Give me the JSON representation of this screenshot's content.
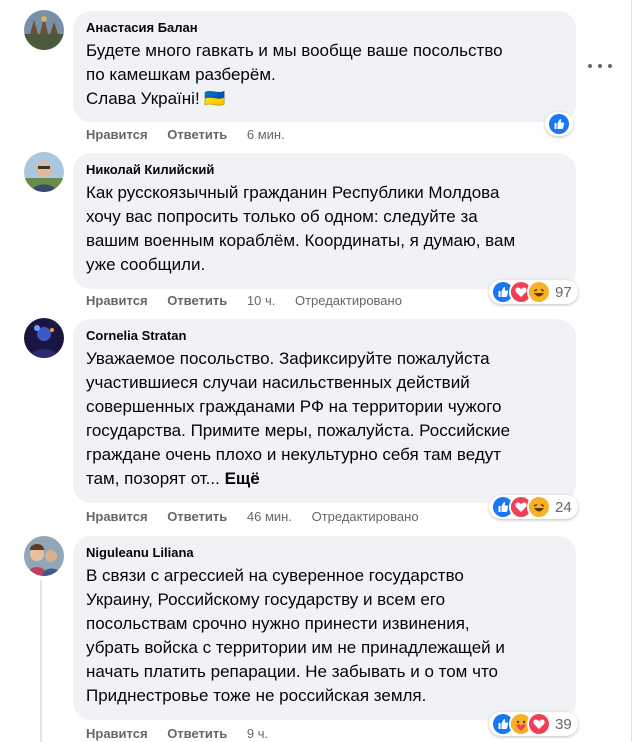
{
  "comments": [
    {
      "author": "Анастасия Балан",
      "text": "Будете много гавкать и мы вообще ваше посольство\nпо камешкам разберём.\nСлава Україні! 🇺🇦",
      "like": "Нравится",
      "reply": "Ответить",
      "time": "6 мин.",
      "edited": "",
      "reactions": [
        "like"
      ],
      "count": ""
    },
    {
      "author": "Николай Килийский",
      "text": "Как русскоязычный гражданин Республики Молдова\nхочу вас попросить только об одном: следуйте за\nвашим военным кораблём. Координаты, я думаю, вам\nуже сообщили.",
      "like": "Нравится",
      "reply": "Ответить",
      "time": "10 ч.",
      "edited": "Отредактировано",
      "reactions": [
        "like",
        "love",
        "haha"
      ],
      "count": "97"
    },
    {
      "author": "Cornelia Stratan",
      "text": "Уважаемое посольство. Зафиксируйте пожалуйста\nучастившиеся случаи насильственных действий\nсовершенных гражданами РФ на территории чужого\nгосударства. Примите меры, пожалуйста. Российские\nграждане очень плохо и некультурно себя там ведут\nтам, позорят от...",
      "more": "Ещё",
      "like": "Нравится",
      "reply": "Ответить",
      "time": "46 мин.",
      "edited": "Отредактировано",
      "reactions": [
        "like",
        "love",
        "haha"
      ],
      "count": "24"
    },
    {
      "author": "Niguleanu Liliana",
      "text": "В связи с агрессией на суверенное государство\nУкраину, Российскому государству и всем его\nпосольствам срочно нужно принести извинения,\nубрать войска с территории им не принадлежащей и\nначать платить репарации. Не забывать и о том что\nПриднестровье тоже не российская земля.",
      "like": "Нравится",
      "reply": "Ответить",
      "time": "9 ч.",
      "edited": "",
      "reactions": [
        "like",
        "care",
        "love"
      ],
      "count": "39"
    }
  ],
  "icons": {
    "more": "more-horizontal-icon"
  },
  "colors": {
    "bubble": "#f0f2f5",
    "meta": "#65676b",
    "like": "#1877f2",
    "love": "#f33e58",
    "haha": "#f7b125"
  }
}
